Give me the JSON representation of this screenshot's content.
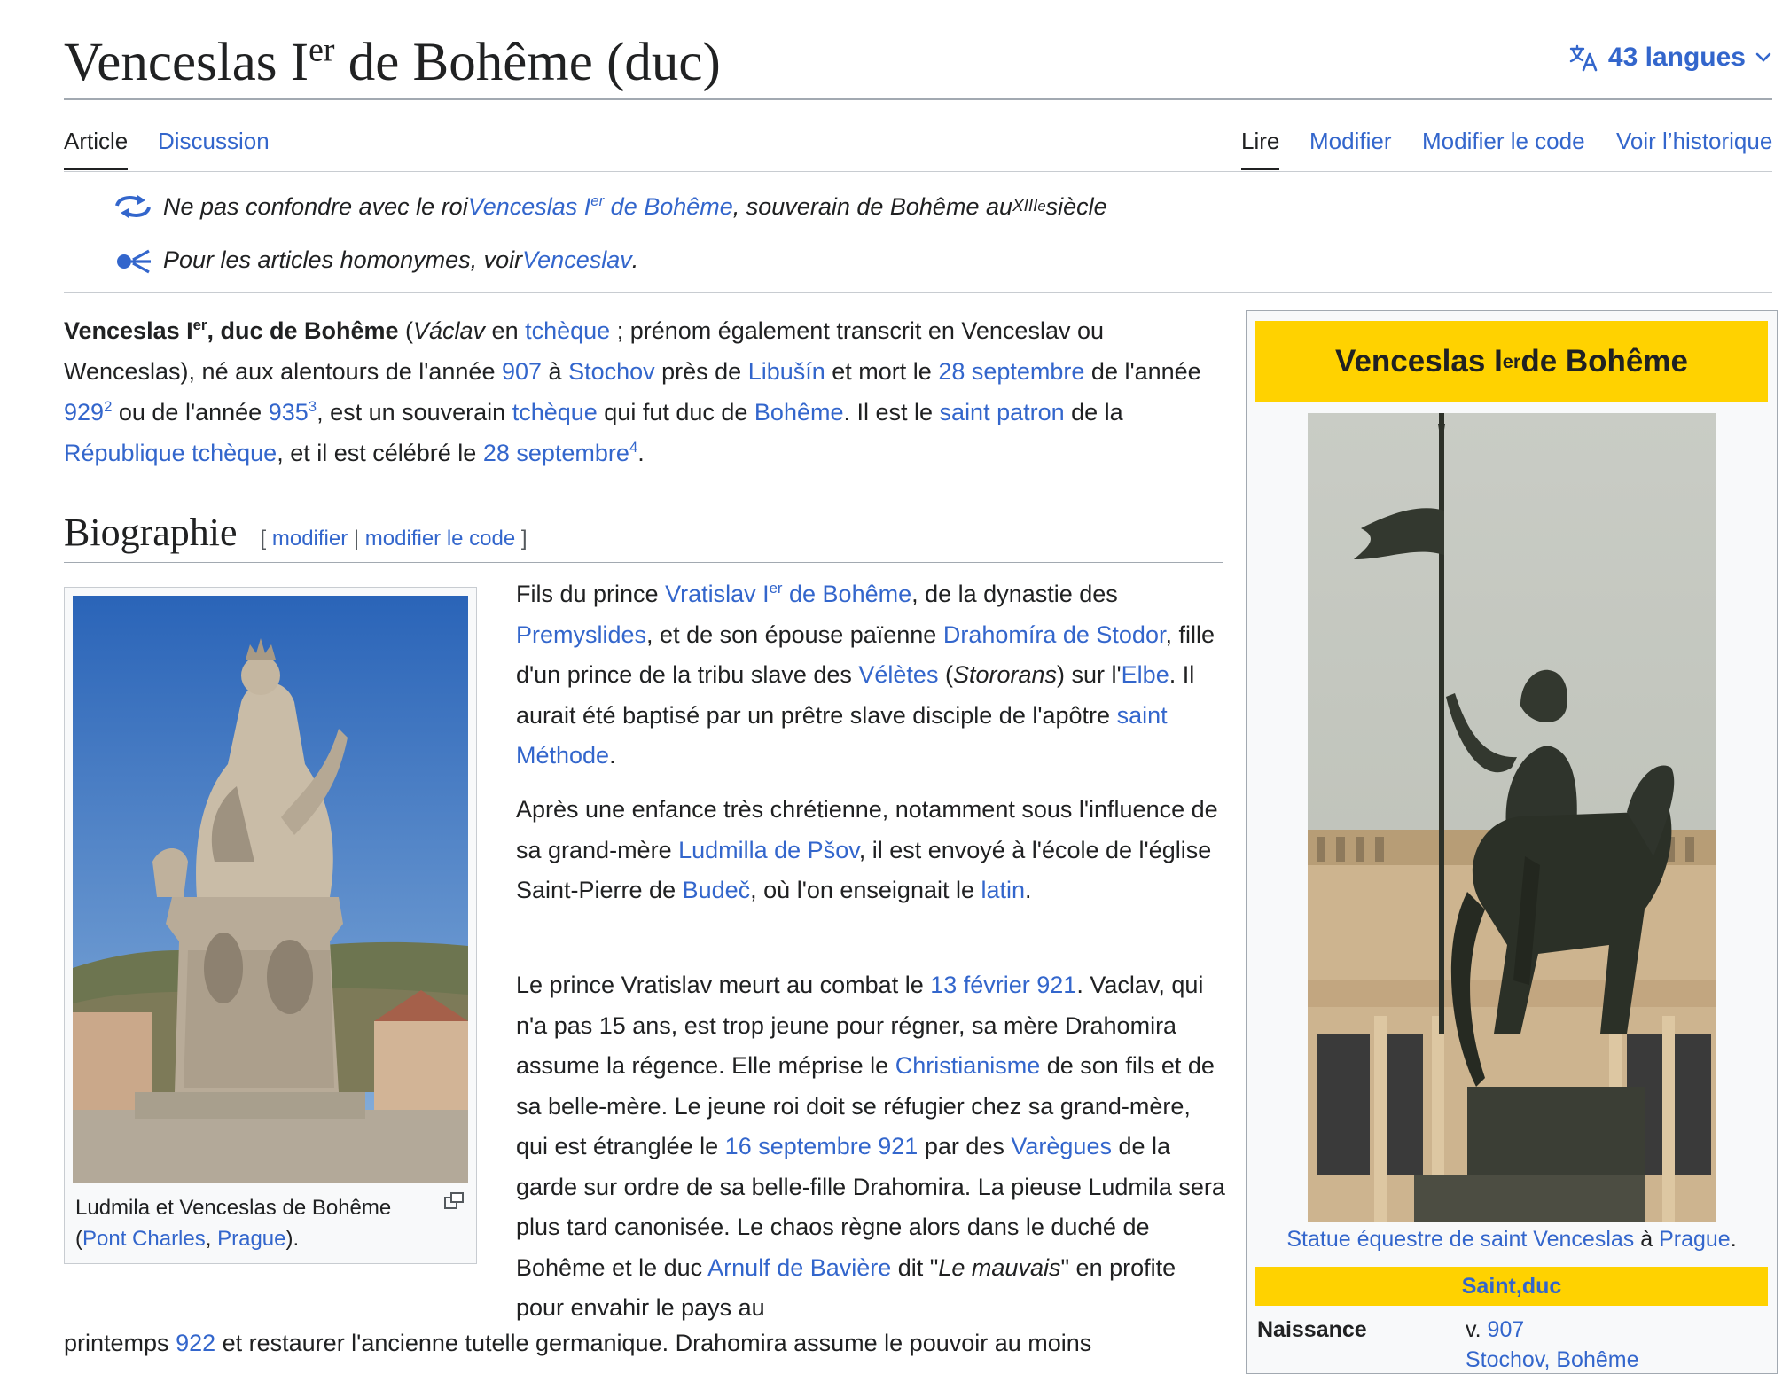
{
  "header": {
    "title_main": "Venceslas I",
    "title_sup": "er",
    "title_rest": " de Bohême (duc)",
    "languages_label": "43 langues"
  },
  "tabs": {
    "left": [
      {
        "label": "Article",
        "selected": true
      },
      {
        "label": "Discussion",
        "selected": false
      }
    ],
    "right": [
      {
        "label": "Lire",
        "selected": true
      },
      {
        "label": "Modifier",
        "selected": false
      },
      {
        "label": "Modifier le code",
        "selected": false
      },
      {
        "label": "Voir l’historique",
        "selected": false
      }
    ]
  },
  "hatnotes": {
    "h1": {
      "t1": "Ne pas confondre avec le roi ",
      "link_a": "Venceslas I",
      "link_sup": "er",
      "link_b": " de Bohême",
      "t2": ", souverain de Bohême au ",
      "century": "XIII",
      "century_sup": "e",
      "t3": " siècle"
    },
    "h2": {
      "t1": "Pour les articles homonymes, voir ",
      "link": "Venceslav",
      "t2": "."
    }
  },
  "intro": {
    "b1": "Venceslas I",
    "b1_sup": "er",
    "b2": ", duc de Bohême",
    "t1": " (",
    "i1": "Václav",
    "t2": " en ",
    "l1": "tchèque",
    "t3": " ; prénom également transcrit en Venceslav ou Wenceslas), né aux alentours de l'année ",
    "l2": "907",
    "t4": " à ",
    "l3": "Stochov",
    "t5": " près de ",
    "l4": "Libušín",
    "t6": " et mort le ",
    "l5": "28 septembre",
    "t7": " de l'année ",
    "l6": "929",
    "r1": "2",
    "t8": " ou de l'année ",
    "l7": "935",
    "r2": "3",
    "t9": ", est un souverain ",
    "l8": "tchèque",
    "t10": " qui fut duc de ",
    "l9": "Bohême",
    "t11": ". Il est le ",
    "l10": "saint patron",
    "t12": " de la ",
    "l11": "République tchèque",
    "t13": ", et il est célébré le ",
    "l12": "28 septembre",
    "r3": "4",
    "t14": "."
  },
  "section": {
    "title": "Biographie",
    "edit_open": "[ ",
    "edit_link1": "modifier",
    "edit_sep": " | ",
    "edit_link2": "modifier le code",
    "edit_close": " ]"
  },
  "thumbnail": {
    "caption_t1": "Ludmila et Venceslas de Bohême (",
    "caption_l1": "Pont Charles",
    "caption_t2": ", ",
    "caption_l2": "Prague",
    "caption_t3": ")."
  },
  "paragraphs": {
    "p1": {
      "t1": "Fils du prince ",
      "l1": "Vratislav I",
      "l1_sup": "er",
      "l1b": " de Bohême",
      "t2": ", de la dynastie des ",
      "l2": "Premyslides",
      "t3": ", et de son épouse païenne ",
      "l3": "Drahomíra de Stodor",
      "t4": ", fille d'un prince de la tribu slave des ",
      "l4": "Vélètes",
      "t5": " (",
      "i1": "Stororans",
      "t6": ") sur l'",
      "l5": "Elbe",
      "t7": ". Il aurait été baptisé par un prêtre slave disciple de l'apôtre ",
      "l6": "saint Méthode",
      "t8": "."
    },
    "p2": {
      "t1": "Après une enfance très chrétienne, notamment sous l'influence de sa grand-mère ",
      "l1": "Ludmilla de Pšov",
      "t2": ", il est envoyé à l'école de l'église Saint-Pierre de ",
      "l2": "Budeč",
      "t3": ", où l'on enseignait le ",
      "l3": "latin",
      "t4": "."
    },
    "p3": {
      "t1": "Le prince Vratislav meurt au combat le ",
      "l1": "13 février 921",
      "t2": ". Vaclav, qui n'a pas 15 ans, est trop jeune pour régner, sa mère Drahomira assume la régence. Elle méprise le ",
      "l2": "Christianisme",
      "t3": " de son fils et de sa belle-mère. Le jeune roi doit se réfugier chez sa grand-mère, qui est étranglée le ",
      "l3": "16 septembre 921",
      "t4": " par des ",
      "l4": "Varègues",
      "t5": " de la garde sur ordre de sa belle-fille Drahomira. La pieuse Ludmila sera plus tard canonisée. Le chaos règne alors dans le duché de Bohême et le duc ",
      "l5": "Arnulf de Bavière",
      "t6": " dit \"",
      "i1": "Le mauvais",
      "t7": "\" en profite pour envahir le pays au"
    },
    "bottom": {
      "t1": "printemps ",
      "l1": "922",
      "t2": " et restaurer l'ancienne tutelle germanique. Drahomira assume le pouvoir au moins"
    }
  },
  "infobox": {
    "title": "Venceslas I",
    "title_sup": "er",
    "title_rest": " de Bohême",
    "caption_l1": "Statue équestre de saint Venceslas",
    "caption_t1": " à ",
    "caption_l2": "Prague",
    "caption_t2": ".",
    "subtitle_l1": "Saint",
    "subtitle_t1": ", ",
    "subtitle_l2": "duc",
    "row_label": "Naissance",
    "row_value_prefix": "v. ",
    "row_value_link": "907",
    "row_value_next": "Stochov, Bohême"
  },
  "colors": {
    "link": "#3366cc",
    "text": "#202122",
    "infobox_header": "#ffd200",
    "infobox_bg": "#f8f9fa",
    "border": "#a2a9b1"
  }
}
